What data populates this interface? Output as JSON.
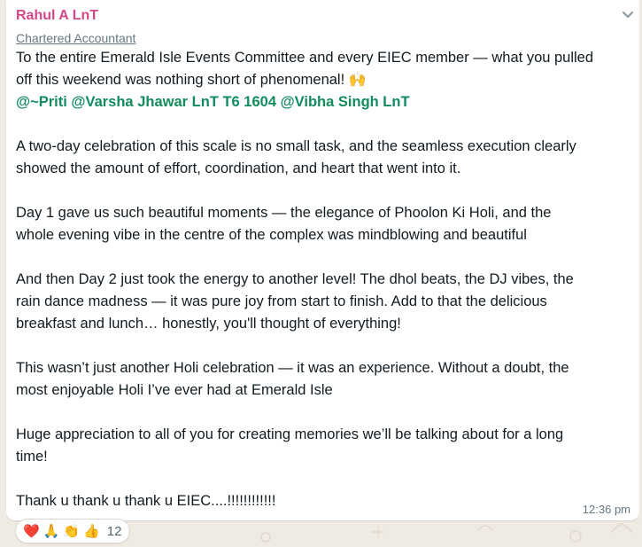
{
  "message": {
    "sender": "Rahul A LnT",
    "subtitle": "Chartered Accountant",
    "line1": "To the entire Emerald Isle Events Committee and every EIEC member — what you pulled",
    "line2": "off this weekend was nothing short of phenomenal! ",
    "line2_emoji": "🙌",
    "mentions": "@~Priti @Varsha Jhawar LnT T6 1604 @Vibha Singh LnT",
    "para1_line1": "A two-day celebration of this scale is no small task, and the seamless execution clearly",
    "para1_line2": "showed the amount of effort, coordination, and heart that went into it.",
    "para2_line1": "Day 1 gave us such beautiful moments — the elegance of Phoolon Ki Holi, and the",
    "para2_line2": "whole evening vibe in the centre of the complex was mindblowing and beautiful",
    "para3_line1": "And then Day 2 just took the energy to another level! The dhol beats, the DJ vibes, the",
    "para3_line2": "rain dance madness — it was pure joy from start to finish. Add to that the delicious",
    "para3_line3": "breakfast and lunch… honestly, you'll thought of everything!",
    "para4_line1": "This wasn’t just another Holi celebration — it was an experience. Without a doubt, the",
    "para4_line2": "most enjoyable Holi I’ve ever had at Emerald Isle",
    "para5_line1": "Huge appreciation to all of you for creating memories we’ll be talking about for a long",
    "para5_line2": "time!",
    "para6_line1": "Thank u thank u thank u EIEC....!!!!!!!!!!!!",
    "time": "12:36 pm"
  },
  "reactions": {
    "emojis": [
      "❤️",
      "🙏",
      "👏",
      "👍"
    ],
    "count": "12"
  },
  "icons": {
    "menu_chevron": "chevron-down-icon"
  },
  "colors": {
    "sender": "#d6478a",
    "mentions": "#128c5e",
    "chat_background": "#efeae2",
    "bubble": "#ffffff"
  }
}
